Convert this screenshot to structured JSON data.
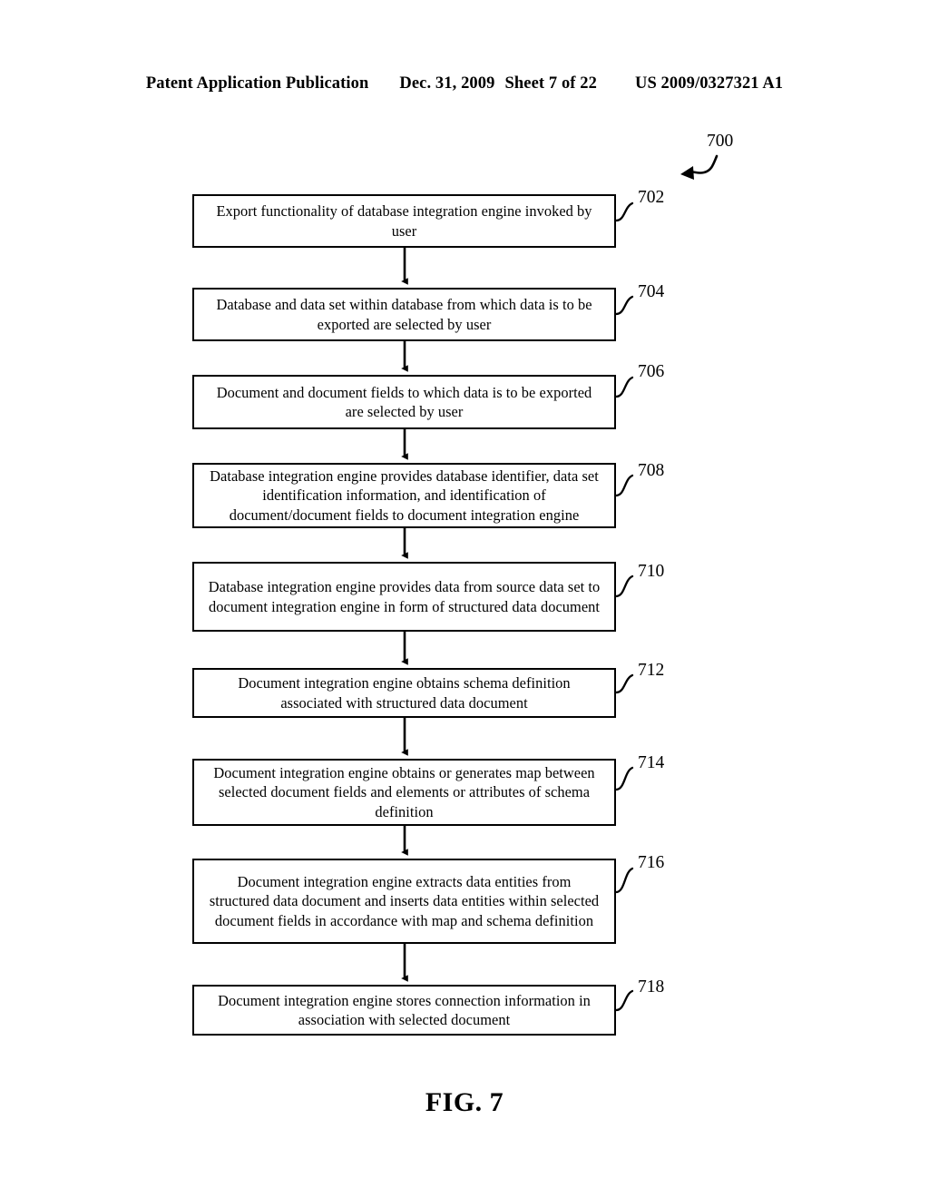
{
  "header": {
    "publication": "Patent Application Publication",
    "date": "Dec. 31, 2009",
    "sheet": "Sheet 7 of 22",
    "patent_number": "US 2009/0327321 A1"
  },
  "figure": {
    "caption": "FIG. 7",
    "diagram_ref": "700"
  },
  "flowchart": {
    "nodes": [
      {
        "ref": "702",
        "text": "Export functionality of database integration engine invoked by user"
      },
      {
        "ref": "704",
        "text": "Database and data set within database from which data is to be exported are selected by user"
      },
      {
        "ref": "706",
        "text": "Document and document fields to which data is to be exported are selected by user"
      },
      {
        "ref": "708",
        "text": "Database integration engine provides database identifier, data set identification information, and identification of document/document fields to document integration engine"
      },
      {
        "ref": "710",
        "text": "Database integration engine provides data from source data set to document integration engine in form of structured data document"
      },
      {
        "ref": "712",
        "text": "Document integration engine obtains schema definition associated with structured data document"
      },
      {
        "ref": "714",
        "text": "Document integration engine obtains or generates map between selected document fields and elements or attributes of schema definition"
      },
      {
        "ref": "716",
        "text": "Document integration engine extracts data entities from structured data document and inserts data entities within selected document fields in accordance with map and schema definition"
      },
      {
        "ref": "718",
        "text": "Document integration engine stores connection information in association with selected document"
      }
    ]
  }
}
